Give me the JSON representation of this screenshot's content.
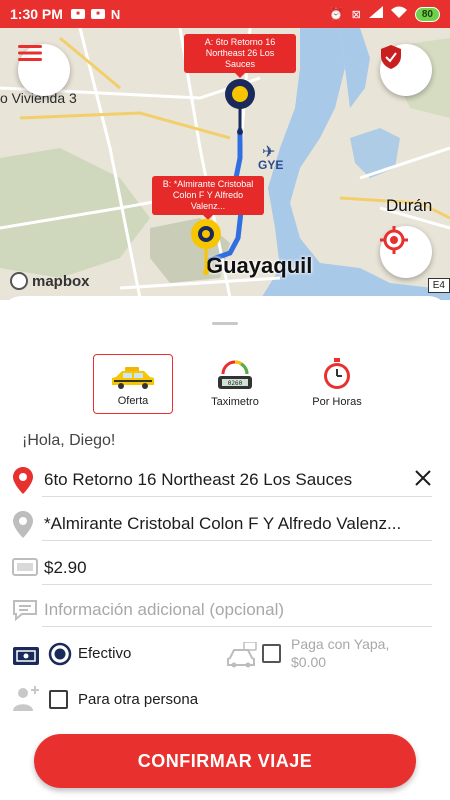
{
  "status_bar": {
    "time": "1:30 PM",
    "battery": "80"
  },
  "map": {
    "callout_a": "A: 6to Retorno 16 Northeast 26 Los Sauces",
    "callout_b": "B: *Almirante Cristobal Colon F Y Alfredo Valenz...",
    "labels": {
      "vivienda": "o Vivienda 3",
      "gye": "GYE",
      "duran": "Durán",
      "city": "Guayaquil",
      "mapbox": "mapbox",
      "road": "E4"
    }
  },
  "services": [
    {
      "label": "Oferta",
      "icon": "taxi-icon",
      "active": true
    },
    {
      "label": "Taximetro",
      "icon": "taximeter-icon",
      "active": false
    },
    {
      "label": "Por Horas",
      "icon": "stopwatch-icon",
      "active": false
    }
  ],
  "greeting": "¡Hola, Diego!",
  "origin": "6to Retorno 16 Northeast 26 Los Sauces",
  "destination": "*Almirante Cristobal Colon F Y Alfredo Valenz...",
  "price": "$2.90",
  "additional_info_placeholder": "Información adicional (opcional)",
  "payment": {
    "cash_label": "Efectivo",
    "yapa_label": "Paga con Yapa,",
    "yapa_amount": "$0.00"
  },
  "other_person_label": "Para otra persona",
  "confirm_button": "CONFIRMAR VIAJE",
  "colors": {
    "brand_red": "#e8312f",
    "pin_yellow": "#f7c600",
    "route_blue": "#2f6fe0",
    "dark_navy": "#1a2a5a"
  }
}
